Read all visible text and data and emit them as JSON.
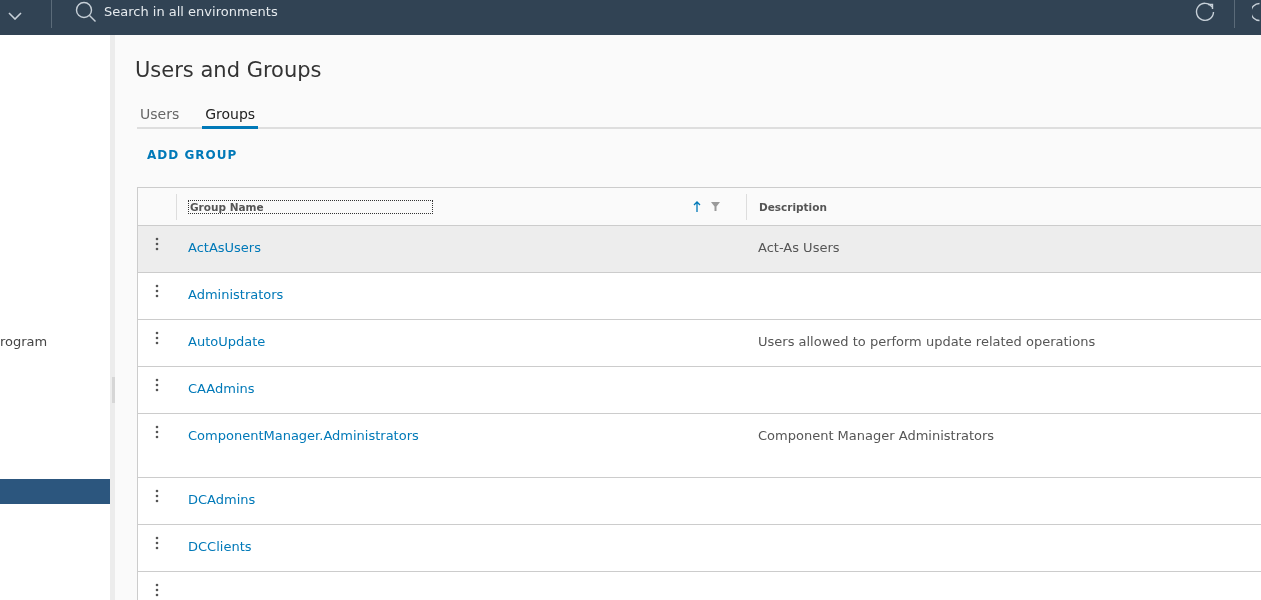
{
  "header": {
    "search": {
      "placeholder": "Search in all environments"
    }
  },
  "sidebar": {
    "items": [
      {
        "label": "rogram",
        "selected": false
      },
      {
        "selected": true
      }
    ]
  },
  "page": {
    "title": "Users and Groups"
  },
  "tabs": [
    {
      "label": "Users",
      "selected": false
    },
    {
      "label": "Groups",
      "selected": true
    }
  ],
  "add_button": "ADD GROUP",
  "table": {
    "columns": [
      {
        "label": "Group Name"
      },
      {
        "label": "Description"
      }
    ],
    "rows": [
      {
        "name": "ActAsUsers",
        "description": "Act-As Users",
        "selected": true
      },
      {
        "name": "Administrators",
        "selected": false
      },
      {
        "name": "AutoUpdate",
        "description": "Users allowed to perform update related operations",
        "selected": false
      },
      {
        "name": "CAAdmins",
        "selected": false
      },
      {
        "name": "ComponentManager.Administrators",
        "description": "Component Manager Administrators",
        "selected": false,
        "tall": true
      },
      {
        "name": "DCAdmins",
        "selected": false
      },
      {
        "name": "DCClients",
        "selected": false
      }
    ]
  }
}
